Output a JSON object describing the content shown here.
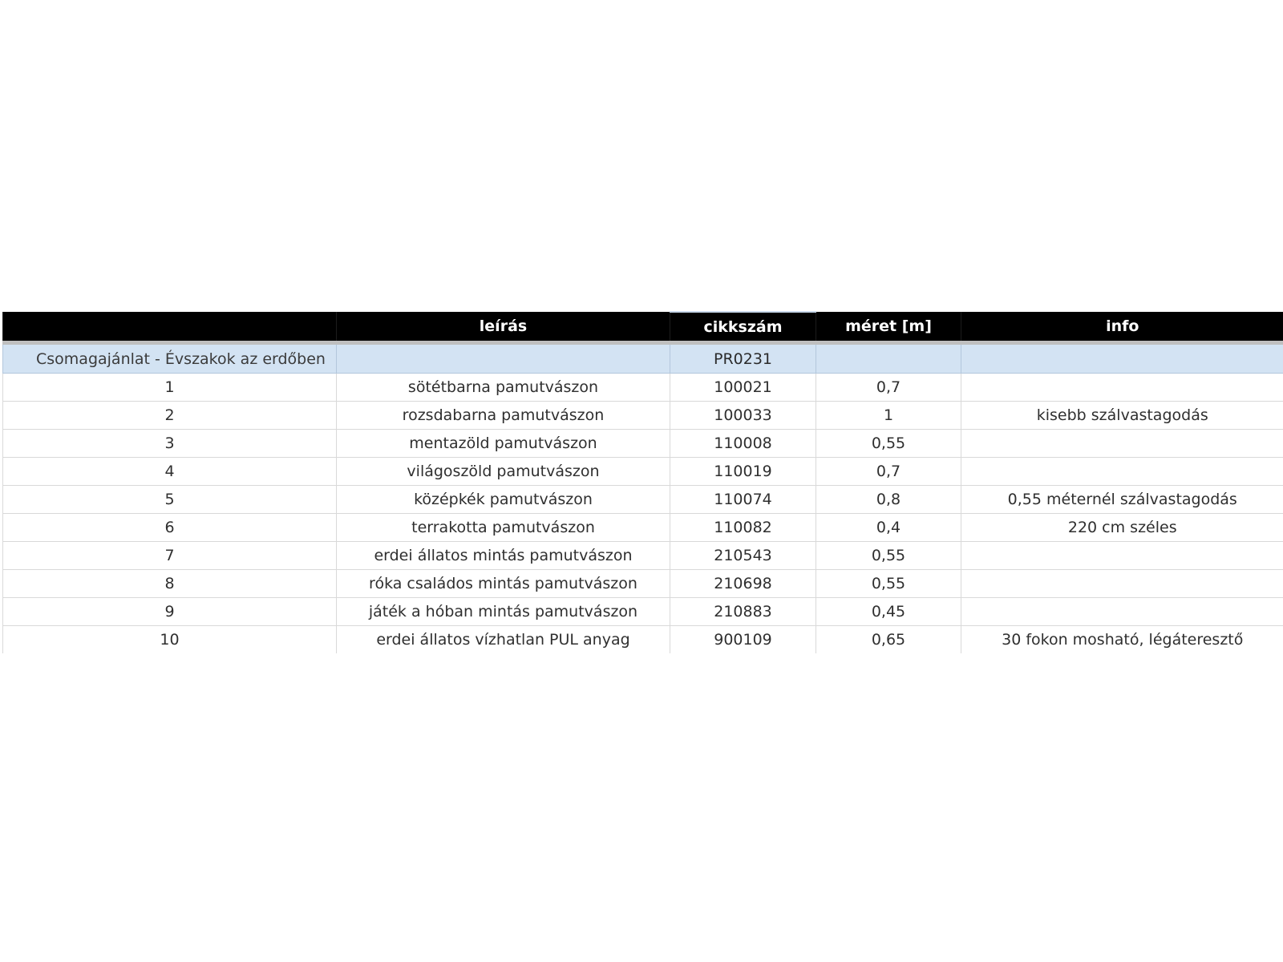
{
  "columns": {
    "c1": "",
    "c2": "leírás",
    "c3": "cikkszám",
    "c4": "méret [m]",
    "c5": "info"
  },
  "package": {
    "name": "Csomagajánlat - Évszakok az erdőben",
    "leiras": "",
    "cikkszam": "PR0231",
    "meret": "",
    "info": ""
  },
  "items": [
    {
      "no": "1",
      "leiras": "sötétbarna pamutvászon",
      "cikkszam": "100021",
      "meret": "0,7",
      "info": ""
    },
    {
      "no": "2",
      "leiras": "rozsdabarna pamutvászon",
      "cikkszam": "100033",
      "meret": "1",
      "info": "kisebb szálvastagodás"
    },
    {
      "no": "3",
      "leiras": "mentazöld pamutvászon",
      "cikkszam": "110008",
      "meret": "0,55",
      "info": ""
    },
    {
      "no": "4",
      "leiras": "világoszöld pamutvászon",
      "cikkszam": "110019",
      "meret": "0,7",
      "info": ""
    },
    {
      "no": "5",
      "leiras": "középkék pamutvászon",
      "cikkszam": "110074",
      "meret": "0,8",
      "info": "0,55 méternél szálvastagodás"
    },
    {
      "no": "6",
      "leiras": "terrakotta pamutvászon",
      "cikkszam": "110082",
      "meret": "0,4",
      "info": "220 cm széles"
    },
    {
      "no": "7",
      "leiras": "erdei állatos mintás pamutvászon",
      "cikkszam": "210543",
      "meret": "0,55",
      "info": ""
    },
    {
      "no": "8",
      "leiras": "róka családos mintás pamutvászon",
      "cikkszam": "210698",
      "meret": "0,55",
      "info": ""
    },
    {
      "no": "9",
      "leiras": "játék a hóban mintás pamutvászon",
      "cikkszam": "210883",
      "meret": "0,45",
      "info": ""
    },
    {
      "no": "10",
      "leiras": "erdei állatos vízhatlan PUL anyag",
      "cikkszam": "900109",
      "meret": "0,65",
      "info": "30 fokon mosható, légáteresztő"
    }
  ]
}
